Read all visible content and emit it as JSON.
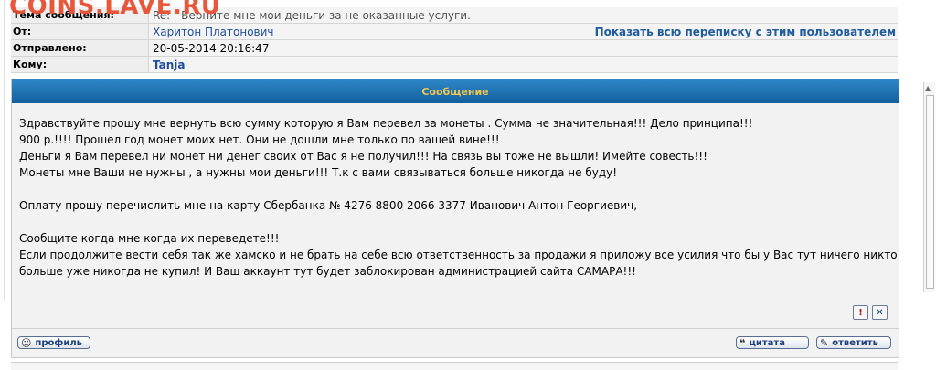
{
  "watermark": "COINS.LAVE.RU",
  "header": {
    "subject_label": "Тема сообщения:",
    "subject_value": "Re: - Верните мне мои деньги за не оказанные услуги.",
    "from_label": "От:",
    "from_value": "Харитон Платонович",
    "show_all_link": "Показать всю переписку с этим пользователем",
    "sent_label": "Отправлено:",
    "sent_value": "20-05-2014 20:16:47",
    "to_label": "Кому:",
    "to_value": "Tanja"
  },
  "panel": {
    "title": "Сообщение",
    "lines": [
      "Здравствуйте прошу мне вернуть всю сумму которую я Вам перевел за монеты . Сумма не значительная!!! Дело принципа!!!",
      "900 р.!!!! Прошел год монет моих нет. Они не дошли мне только по вашей вине!!!",
      "Деньги я Вам перевел ни монет ни денег своих от Вас я не получил!!! На связь вы тоже не вышли! Имейте совесть!!!",
      "Монеты мне Ваши не нужны , а нужны мои деньги!!! Т.к с вами связываться больше никогда не буду!",
      "Оплату прошу перечислить мне на карту Сбербанка № 4276 8800 2066 3377 Иванович Антон Георгиевич,",
      "Сообщите когда мне когда их переведете!!!",
      "Если продолжите вести себя так же хамско и не брать на себе всю ответственность за продажи я приложу все усилия что бы у Вас тут ничего никто",
      "больше уже никогда не купил! И Ваш аккаунт тут будет заблокирован администрацией сайта САМАРА!!!"
    ],
    "report_icon": "!",
    "close_icon": "✕"
  },
  "buttons": {
    "profile": "профиль",
    "quote": "цитата",
    "reply": "ответить"
  }
}
